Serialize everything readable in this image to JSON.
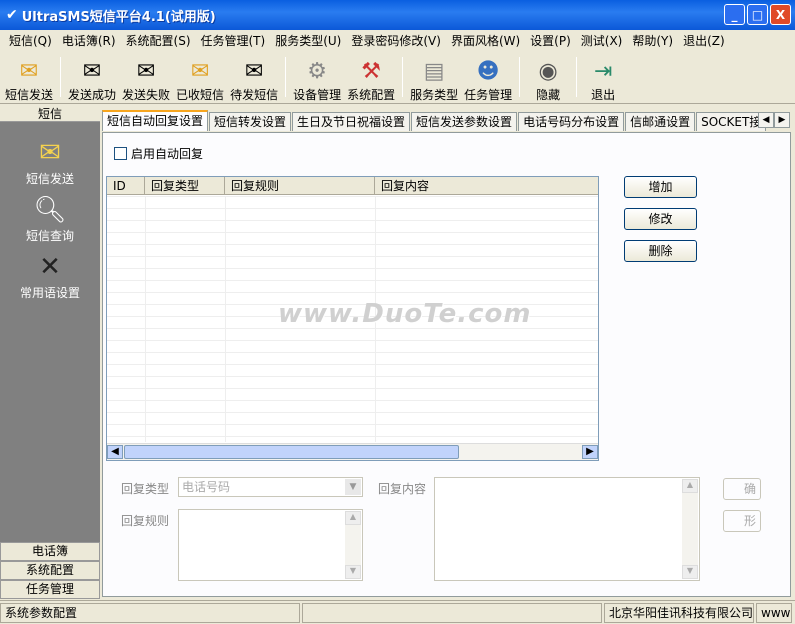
{
  "window": {
    "title": "UltraSMS短信平台4.1(试用版)",
    "min": "_",
    "max": "□",
    "close": "X"
  },
  "menu": [
    "短信(Q)",
    "电话簿(R)",
    "系统配置(S)",
    "任务管理(T)",
    "服务类型(U)",
    "登录密码修改(V)",
    "界面风格(W)",
    "设置(P)",
    "测试(X)",
    "帮助(Y)",
    "退出(Z)"
  ],
  "toolbar": {
    "sms_send": "短信发送",
    "send_success": "发送成功",
    "send_fail": "发送失败",
    "received": "已收短信",
    "pending": "待发短信",
    "device": "设备管理",
    "sysconfig": "系统配置",
    "service": "服务类型",
    "task": "任务管理",
    "hide": "隐藏",
    "exit": "退出"
  },
  "sidebar": {
    "header": "短信",
    "items": [
      "短信发送",
      "短信查询",
      "常用语设置"
    ],
    "bottom": [
      "电话簿",
      "系统配置",
      "任务管理"
    ]
  },
  "tabs": [
    "短信自动回复设置",
    "短信转发设置",
    "生日及节日祝福设置",
    "短信发送参数设置",
    "电话号码分布设置",
    "信邮通设置",
    "SOCKET接"
  ],
  "checkbox": "启用自动回复",
  "grid": {
    "columns": [
      "ID",
      "回复类型",
      "回复规则",
      "回复内容"
    ]
  },
  "buttons": {
    "add": "增加",
    "edit": "修改",
    "delete": "删除"
  },
  "form": {
    "reply_type_label": "回复类型",
    "reply_type_value": "电话号码",
    "reply_rule_label": "回复规则",
    "reply_content_label": "回复内容",
    "btn1": "确",
    "btn2": "形"
  },
  "watermark": "www.DuoTe.com",
  "status": {
    "left": "系统参数配置",
    "right": "北京华阳佳讯科技有限公司",
    "extra": "www"
  }
}
